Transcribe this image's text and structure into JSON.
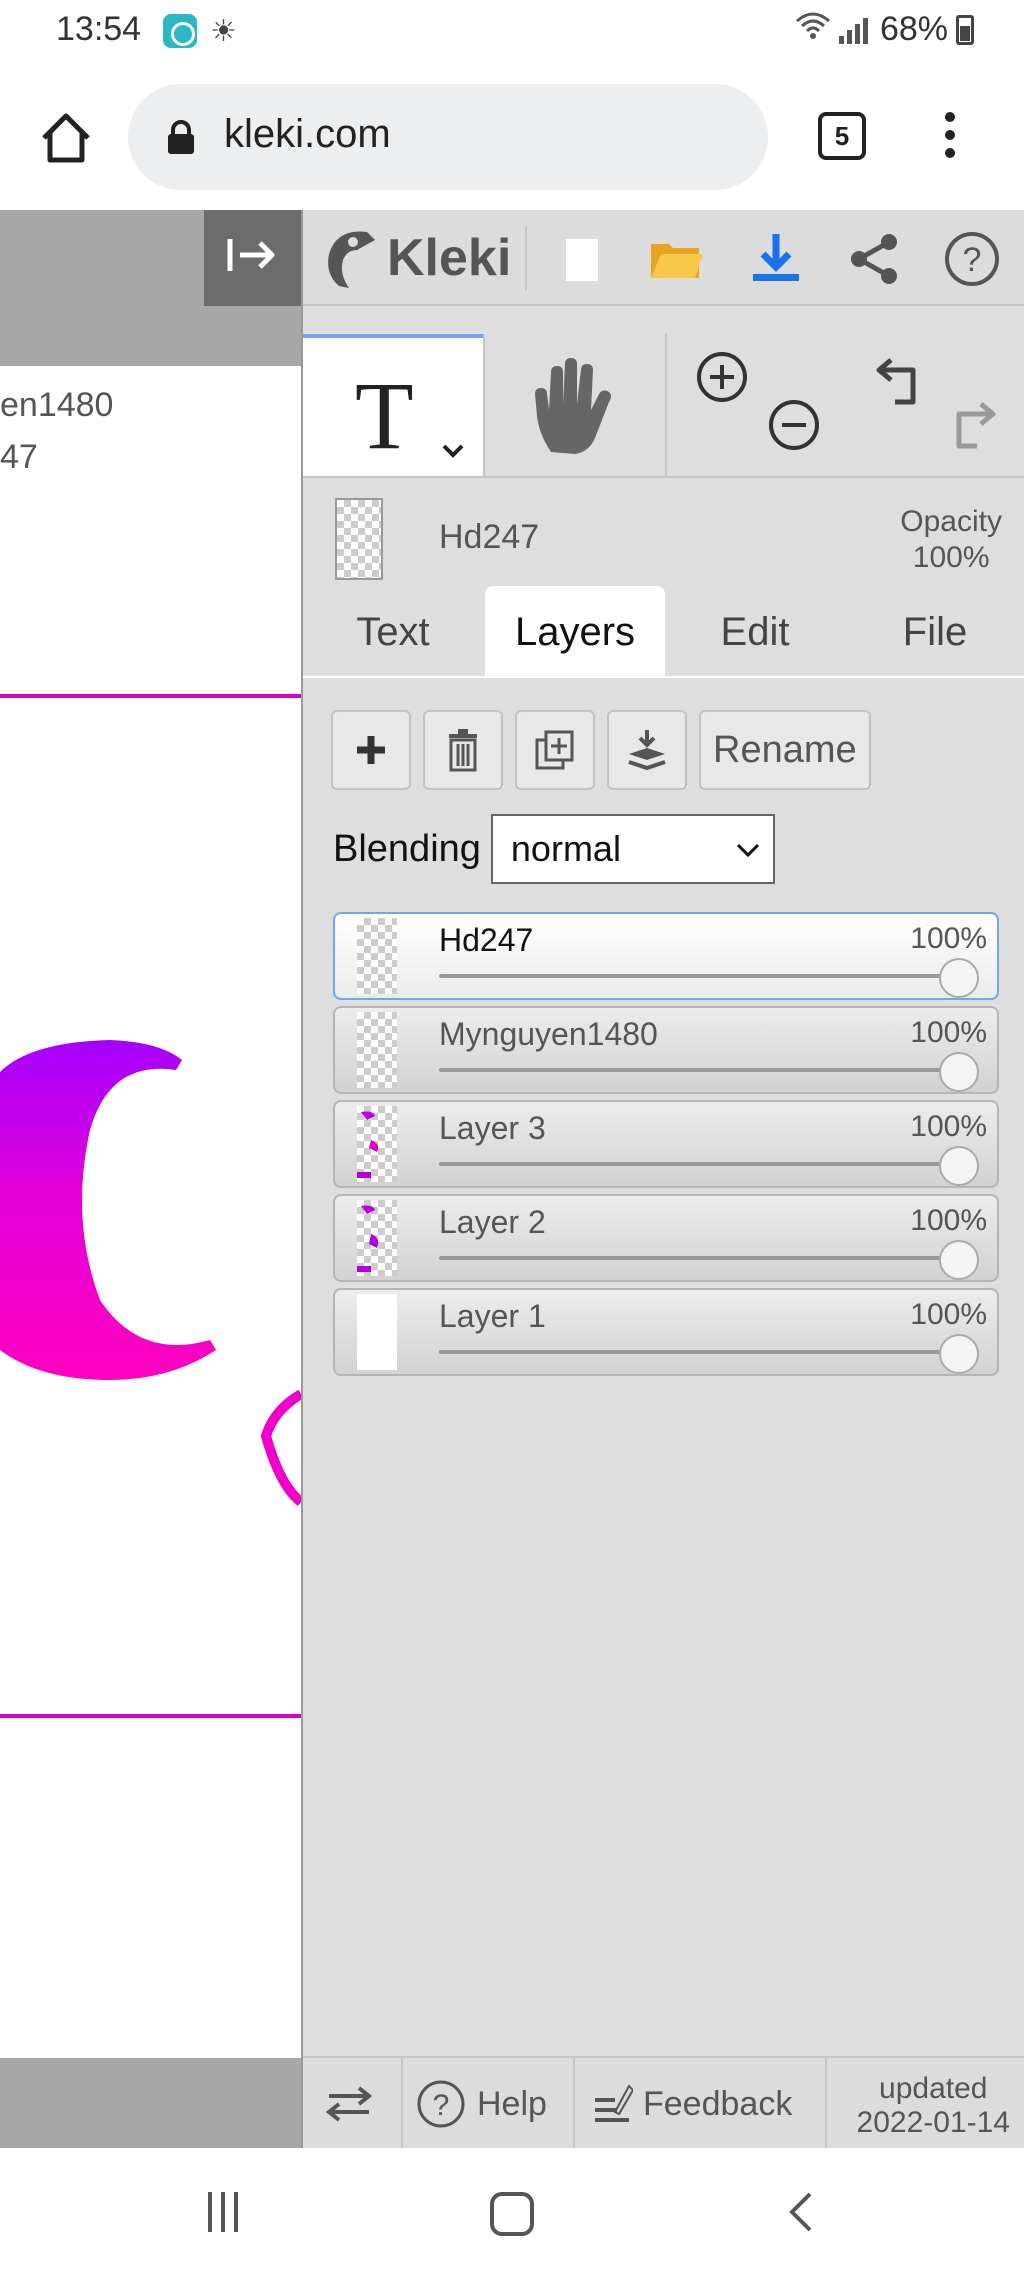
{
  "status_bar": {
    "time": "13:54",
    "battery": "68%",
    "icons": [
      "app-icon",
      "weather-icon",
      "wifi-icon",
      "signal-icon",
      "battery-icon"
    ]
  },
  "browser": {
    "url": "kleki.com",
    "tab_count": "5"
  },
  "canvas": {
    "text_line_1": "en1480",
    "text_line_2": "47",
    "collapse_icon": "collapse-panel-icon",
    "accent_color": "#ee00cc"
  },
  "app": {
    "logo": "Kleki",
    "toolbar_icons": [
      "new-image-icon",
      "open-folder-icon",
      "download-icon",
      "share-icon",
      "help-icon"
    ]
  },
  "tools": {
    "active_tool": "T",
    "items": [
      "text-tool-icon",
      "hand-tool-icon",
      "zoom-in-icon",
      "zoom-out-icon",
      "undo-icon",
      "redo-icon"
    ]
  },
  "current_layer": {
    "name": "Hd247",
    "opacity_label": "Opacity",
    "opacity_value": "100%"
  },
  "tabs": [
    {
      "label": "Text",
      "active": false
    },
    {
      "label": "Layers",
      "active": true
    },
    {
      "label": "Edit",
      "active": false
    },
    {
      "label": "File",
      "active": false
    }
  ],
  "layer_actions": {
    "rename_label": "Rename"
  },
  "blending": {
    "label": "Blending",
    "value": "normal"
  },
  "layers": [
    {
      "name": "Hd247",
      "opacity": "100%",
      "opacity_fraction": 1.0,
      "selected": true
    },
    {
      "name": "Mynguyen1480",
      "opacity": "100%",
      "opacity_fraction": 1.0,
      "selected": false
    },
    {
      "name": "Layer 3",
      "opacity": "100%",
      "opacity_fraction": 1.0,
      "selected": false
    },
    {
      "name": "Layer 2",
      "opacity": "100%",
      "opacity_fraction": 1.0,
      "selected": false
    },
    {
      "name": "Layer 1",
      "opacity": "100%",
      "opacity_fraction": 1.0,
      "selected": false
    }
  ],
  "footer": {
    "help_label": "Help",
    "feedback_label": "Feedback",
    "updated_label": "updated",
    "updated_date": "2022-01-14"
  },
  "colors": {
    "accent_blue": "#73a5ee",
    "download_blue": "#1a73e8",
    "folder_yellow": "#f2b62a",
    "magenta": "#ee00cc",
    "purple": "#a000ee"
  }
}
